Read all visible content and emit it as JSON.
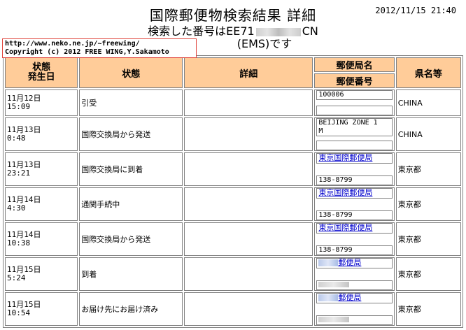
{
  "header": {
    "title": "国際郵便物検索結果 詳細",
    "datetime": "2012/11/15 21:40",
    "subtitle_prefix": "検索した番号はEE71",
    "subtitle_suffix": "CN",
    "subtitle_line2": "(EMS)です"
  },
  "overlay": {
    "url": "http://www.neko.ne.jp/~freewing/",
    "copyright": "Copyright (c) 2012 FREE WING,Y.Sakamoto"
  },
  "table": {
    "headers": {
      "date": "状態\n発生日",
      "status": "状態",
      "detail": "詳細",
      "office_name": "郵便局名",
      "office_code": "郵便番号",
      "prefecture": "県名等"
    },
    "rows": [
      {
        "date": "11月12日\n15:09",
        "status": "引受",
        "detail": "",
        "office": "100006",
        "code": "",
        "pref": "CHINA"
      },
      {
        "date": "11月13日\n0:48",
        "status": "国際交換局から発送",
        "detail": "",
        "office": "BEIJING ZONE 1\nM",
        "code": "",
        "pref": "CHINA"
      },
      {
        "date": "11月13日\n23:21",
        "status": "国際交換局に到着",
        "detail": "",
        "office": "東京国際郵便局",
        "code": "138-8799",
        "pref": "東京都"
      },
      {
        "date": "11月14日\n4:30",
        "status": "通関手続中",
        "detail": "",
        "office": "東京国際郵便局",
        "code": "138-8799",
        "pref": "東京都"
      },
      {
        "date": "11月14日\n10:38",
        "status": "国際交換局から発送",
        "detail": "",
        "office": "東京国際郵便局",
        "code": "138-8799",
        "pref": "東京都"
      },
      {
        "date": "11月15日\n5:24",
        "status": "到着",
        "detail": "",
        "office": "郵便局",
        "code": "",
        "pref": "東京都"
      },
      {
        "date": "11月15日\n10:54",
        "status": "お届け先にお届け済み",
        "detail": "",
        "office": "郵便局",
        "code": "",
        "pref": "東京都"
      }
    ]
  }
}
